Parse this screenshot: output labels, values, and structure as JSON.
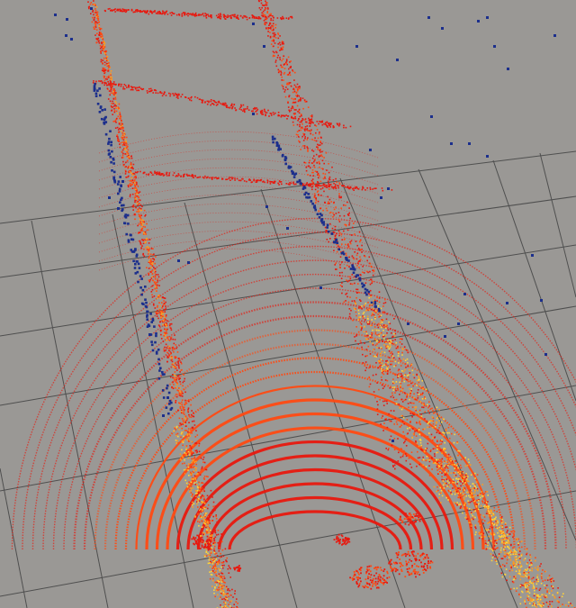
{
  "viewer": {
    "background_color": "#9a9895",
    "grid_color": "#4f4f4f",
    "cloud_colors": {
      "low": "#e8180e",
      "mid": "#ff4a12",
      "high": "#ff9a1e",
      "peak": "#ffd23a",
      "outlier": "#1c2f8c"
    }
  }
}
